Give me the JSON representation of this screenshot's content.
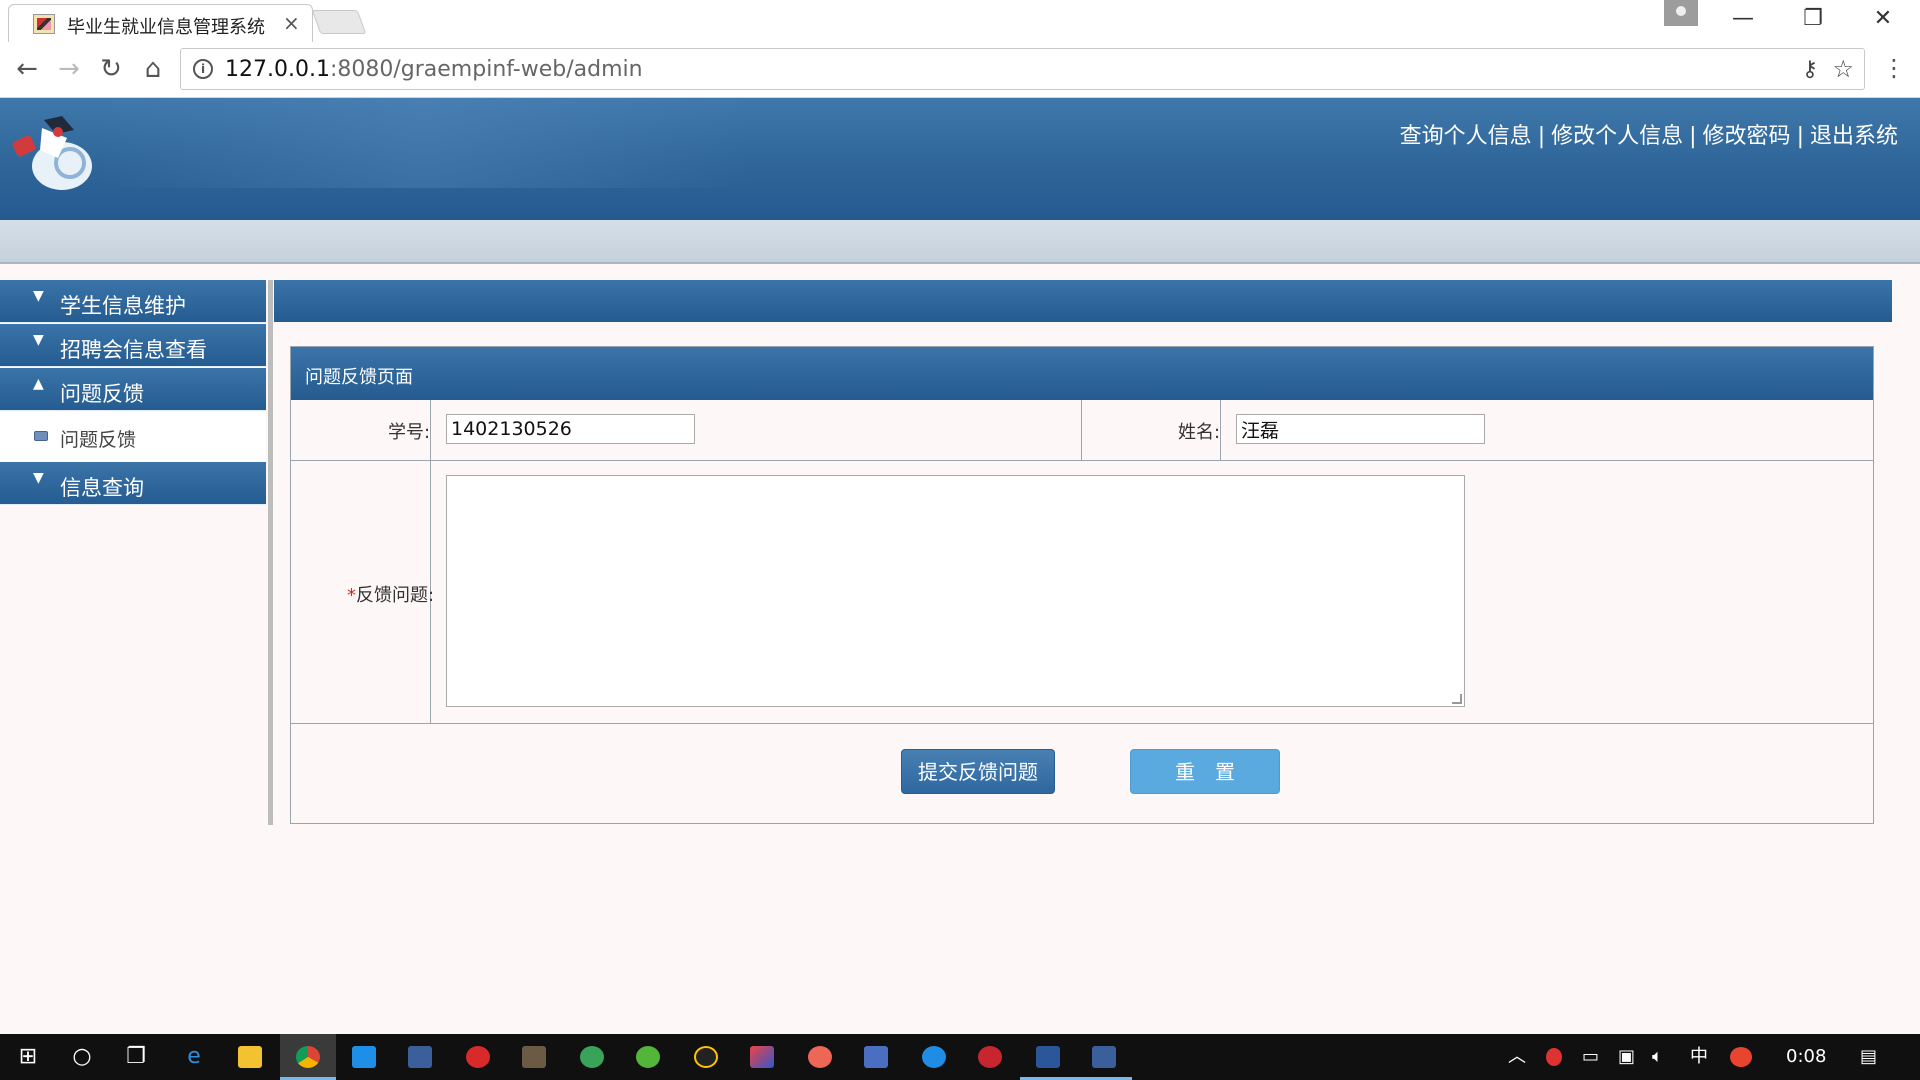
{
  "browser": {
    "tab_title": "毕业生就业信息管理系统",
    "tab_close": "×",
    "url_host": "127.0.0.1",
    "url_rest": ":8080/graempinf-web/admin",
    "info_icon": "i"
  },
  "header": {
    "links": [
      "查询个人信息",
      "修改个人信息",
      "修改密码",
      "退出系统"
    ],
    "separator": "|"
  },
  "sidebar": {
    "sections": [
      {
        "label": "学生信息维护",
        "expanded": false,
        "arrow": "▼"
      },
      {
        "label": "招聘会信息查看",
        "expanded": false,
        "arrow": "▼"
      },
      {
        "label": "问题反馈",
        "expanded": true,
        "arrow": "▲",
        "children": [
          {
            "label": "问题反馈"
          }
        ]
      },
      {
        "label": "信息查询",
        "expanded": false,
        "arrow": "▼"
      }
    ]
  },
  "form": {
    "title": "问题反馈页面",
    "student_id_label": "学号:",
    "student_id_value": "1402130526",
    "name_label": "姓名:",
    "name_value": "汪磊",
    "required_mark": "*",
    "feedback_label": "反馈问题:",
    "feedback_value": "",
    "submit_label": "提交反馈问题",
    "reset_label": "重　置"
  },
  "taskbar": {
    "clock": "0:08",
    "ime": "中"
  },
  "colors": {
    "banner": "#2f669a",
    "page_bg": "#fdf7f7",
    "submit_btn": "#3b74a8",
    "reset_btn": "#5aa9df",
    "required": "#dd2222"
  }
}
